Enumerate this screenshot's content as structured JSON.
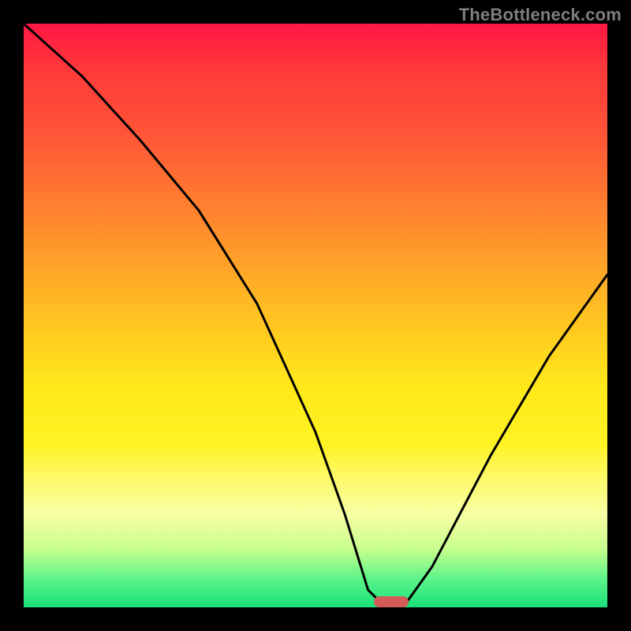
{
  "attribution": "TheBottleneck.com",
  "chart_data": {
    "type": "line",
    "title": "",
    "xlabel": "",
    "ylabel": "",
    "xlim": [
      0,
      100
    ],
    "ylim": [
      0,
      100
    ],
    "x": [
      0,
      10,
      20,
      30,
      40,
      50,
      55,
      59,
      62,
      65,
      70,
      80,
      90,
      100
    ],
    "values": [
      100,
      91,
      80,
      68,
      52,
      30,
      16,
      3,
      0,
      0,
      7,
      26,
      43,
      57
    ],
    "marker": {
      "x_start": 60,
      "x_end": 66,
      "y": 0
    },
    "background_gradient": {
      "stops": [
        {
          "pct": 0,
          "color": "#ff1744"
        },
        {
          "pct": 18,
          "color": "#ff5238"
        },
        {
          "pct": 42,
          "color": "#ffa528"
        },
        {
          "pct": 62,
          "color": "#ffe81a"
        },
        {
          "pct": 84,
          "color": "#f6ffa4"
        },
        {
          "pct": 100,
          "color": "#19e07a"
        }
      ]
    }
  }
}
